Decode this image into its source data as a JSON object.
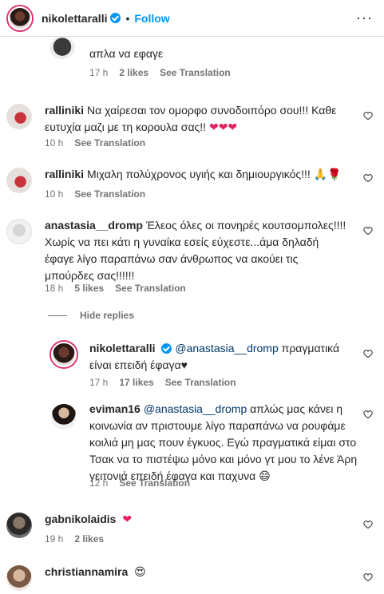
{
  "header": {
    "username": "nikolettaralli",
    "separator": "•",
    "follow_label": "Follow",
    "more": "···"
  },
  "comments": [
    {
      "text": "απλα να εφαγε",
      "time": "17 h",
      "likes": "2 likes",
      "translate": "See Translation"
    },
    {
      "username": "ralliniki",
      "text": "Να χαίρεσαι τον ομορφο συνοδοιπόρο σου!!! Καθε ευτυχία μαζι με τη κορουλα σας!!",
      "emoji": "❤❤❤",
      "time": "10 h",
      "translate": "See Translation"
    },
    {
      "username": "ralliniki",
      "text": "Μιχαλη πολύχρονος υγιής και δημιουργικός!!!",
      "emoji": "🙏🌹",
      "time": "10 h",
      "translate": "See Translation"
    },
    {
      "username": "anastasia__dromp",
      "text": "Έλεος όλες οι πονηρές κουτσομπολες!!!! Χωρίς να πει κάτι η γυναίκα εσείς εύχεστε...άμα δηλαδή έφαγε λίγο παραπάνω σαν άνθρωπος να ακούει τις μπούρδες σας!!!!!!",
      "time": "18 h",
      "likes": "5 likes",
      "translate": "See Translation"
    }
  ],
  "hide_replies_label": "Hide replies",
  "replies": [
    {
      "username": "nikolettaralli",
      "mention": "@anastasia__dromp",
      "text": "πραγματικά είναι επειδή έφαγα♥",
      "time": "17 h",
      "likes": "17 likes",
      "translate": "See Translation"
    },
    {
      "username": "eviman16",
      "mention": "@anastasia__dromp",
      "text": "απλώς μας κάνει η κοινωνία αν πριστουμε λίγο παραπάνω να ρουφάμε κοιλιά μη μας πουν έγκυος. Εγώ πραγματικά είμαι στο Τσακ να το πιστέψω μόνο και μόνο γτ μου το λένε Άρη γειτονιά επειδή έφαγα και παχυνα",
      "emoji": "😄",
      "time": "12 h",
      "translate": "See Translation"
    }
  ],
  "bottom_comments": [
    {
      "username": "gabnikolaidis",
      "emoji": "❤",
      "time": "19 h",
      "likes": "2 likes"
    },
    {
      "username": "christiannamira",
      "emoji": "😍"
    }
  ],
  "colors": {
    "accent": "#0095f6",
    "text": "#262626",
    "secondary": "#737373",
    "mention": "#00376b",
    "heart": "#e0245e"
  }
}
